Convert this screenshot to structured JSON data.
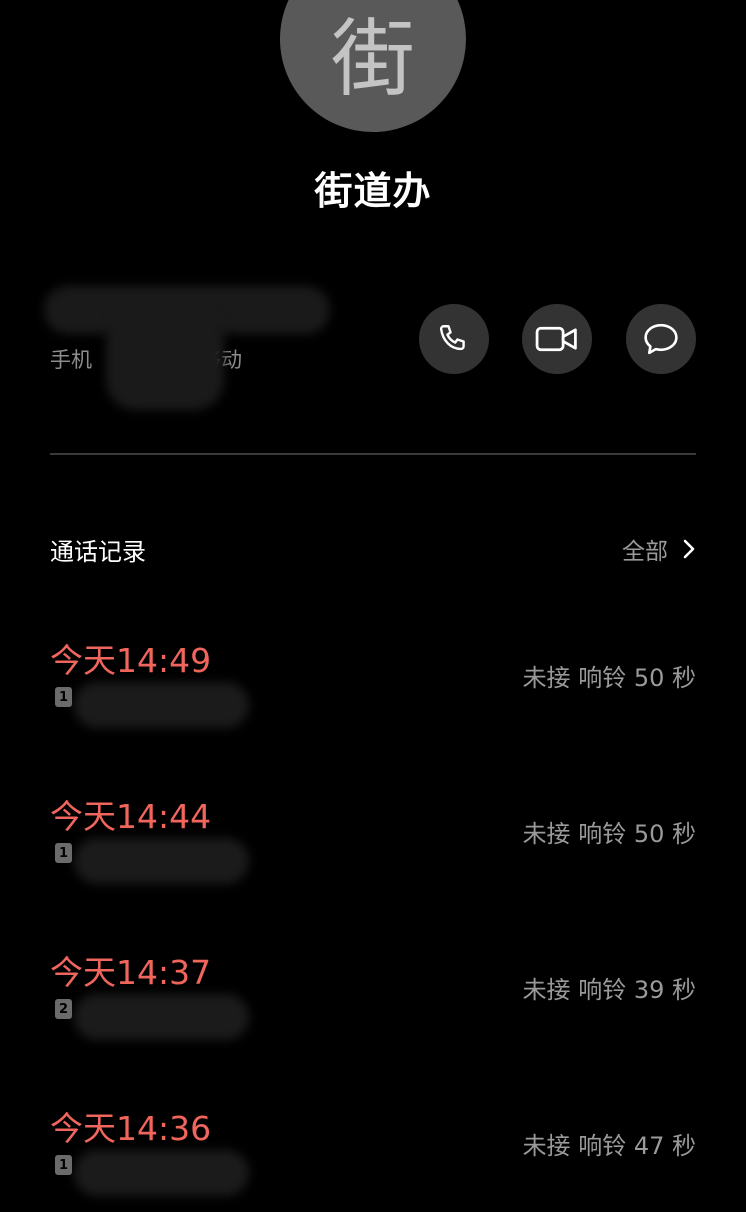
{
  "contact": {
    "avatar_char": "街",
    "name": "街道办",
    "phone_label_prefix": "手机",
    "phone_label_suffix": "移动"
  },
  "actions": [
    {
      "name": "call",
      "icon": "phone-icon"
    },
    {
      "name": "video",
      "icon": "video-camera-icon"
    },
    {
      "name": "message",
      "icon": "message-bubble-icon"
    }
  ],
  "call_log": {
    "title": "通话记录",
    "see_all": "全部",
    "entries": [
      {
        "time": "今天14:49",
        "sim": "1",
        "status": "未接  响铃 50 秒"
      },
      {
        "time": "今天14:44",
        "sim": "1",
        "status": "未接  响铃 50 秒"
      },
      {
        "time": "今天14:37",
        "sim": "2",
        "status": "未接  响铃 39 秒"
      },
      {
        "time": "今天14:36",
        "sim": "1",
        "status": "未接  响铃 47 秒"
      }
    ]
  },
  "colors": {
    "background": "#000000",
    "missed_call": "#f0655c",
    "button_bg": "#333333",
    "avatar_bg": "#595959"
  }
}
